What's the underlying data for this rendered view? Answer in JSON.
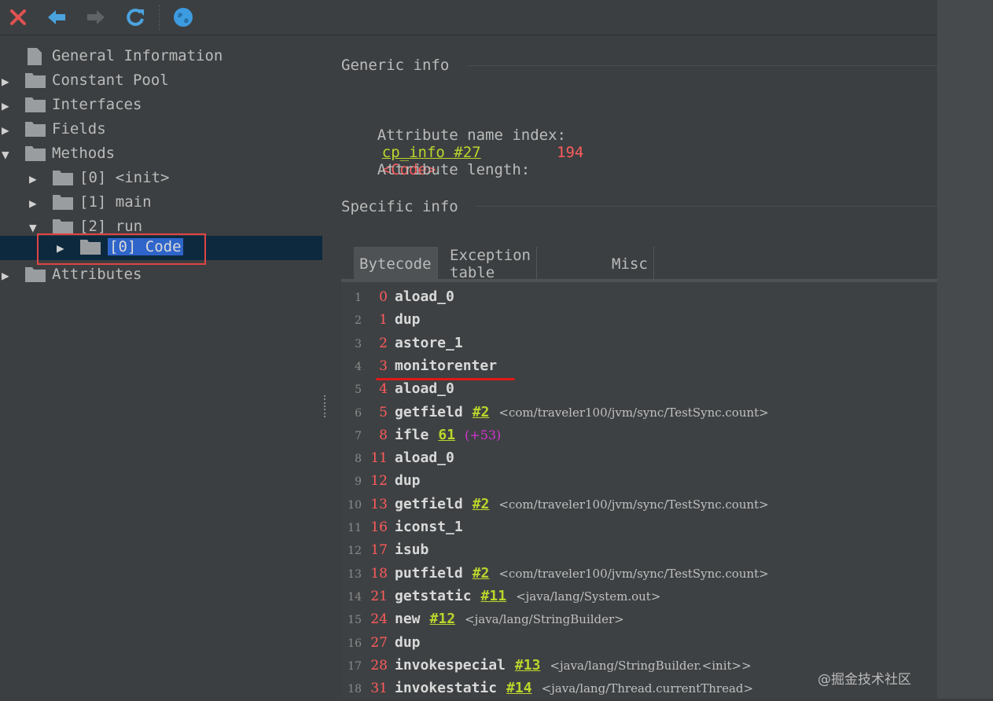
{
  "toolbar": {
    "buttons": [
      {
        "name": "close-button",
        "icon": "close-icon",
        "color": "#e05252"
      },
      {
        "name": "back-button",
        "icon": "arrow-left-icon",
        "color": "#4aa3df"
      },
      {
        "name": "forward-button",
        "icon": "arrow-right-icon",
        "color": "#666666"
      },
      {
        "name": "refresh-button",
        "icon": "refresh-icon",
        "color": "#4aa3df"
      },
      {
        "name": "browser-button",
        "icon": "globe-icon",
        "color": "#3d9be0"
      }
    ]
  },
  "tree": {
    "items": [
      {
        "label": "General Information",
        "icon": "file-icon",
        "expanded": null
      },
      {
        "label": "Constant Pool",
        "icon": "folder-icon",
        "expanded": false
      },
      {
        "label": "Interfaces",
        "icon": "folder-icon",
        "expanded": false
      },
      {
        "label": "Fields",
        "icon": "folder-icon",
        "expanded": false
      },
      {
        "label": "Methods",
        "icon": "folder-icon",
        "expanded": true
      },
      {
        "label": "[0] <init>",
        "icon": "folder-icon",
        "expanded": false
      },
      {
        "label": "[1] main",
        "icon": "folder-icon",
        "expanded": false
      },
      {
        "label": "[2] run",
        "icon": "folder-icon",
        "expanded": true
      },
      {
        "label": "[0] Code",
        "icon": "folder-icon",
        "expanded": false,
        "selected": true
      },
      {
        "label": "Attributes",
        "icon": "folder-icon",
        "expanded": false
      }
    ]
  },
  "generic": {
    "title": "Generic info",
    "name_index_label": "Attribute name index:",
    "name_index_link": "cp_info #27",
    "name_index_value": "<Code>",
    "length_label": "Attribute length:",
    "length_value": "194"
  },
  "specific": {
    "title": "Specific info",
    "tabs": [
      "Bytecode",
      "Exception table",
      "Misc"
    ],
    "active_tab": "Bytecode"
  },
  "bytecode": [
    {
      "n": "1",
      "off": "0",
      "op": "aload_0"
    },
    {
      "n": "2",
      "off": "1",
      "op": "dup"
    },
    {
      "n": "3",
      "off": "2",
      "op": "astore_1"
    },
    {
      "n": "4",
      "off": "3",
      "op": "monitorenter"
    },
    {
      "n": "5",
      "off": "4",
      "op": "aload_0"
    },
    {
      "n": "6",
      "off": "5",
      "op": "getfield",
      "ref": "#2",
      "cmt": "<com/traveler100/jvm/sync/TestSync.count>"
    },
    {
      "n": "7",
      "off": "8",
      "op": "ifle",
      "ref": "61",
      "jmp": "(+53)"
    },
    {
      "n": "8",
      "off": "11",
      "op": "aload_0"
    },
    {
      "n": "9",
      "off": "12",
      "op": "dup"
    },
    {
      "n": "10",
      "off": "13",
      "op": "getfield",
      "ref": "#2",
      "cmt": "<com/traveler100/jvm/sync/TestSync.count>"
    },
    {
      "n": "11",
      "off": "16",
      "op": "iconst_1"
    },
    {
      "n": "12",
      "off": "17",
      "op": "isub"
    },
    {
      "n": "13",
      "off": "18",
      "op": "putfield",
      "ref": "#2",
      "cmt": "<com/traveler100/jvm/sync/TestSync.count>"
    },
    {
      "n": "14",
      "off": "21",
      "op": "getstatic",
      "ref": "#11",
      "cmt": "<java/lang/System.out>"
    },
    {
      "n": "15",
      "off": "24",
      "op": "new",
      "ref": "#12",
      "cmt": "<java/lang/StringBuilder>"
    },
    {
      "n": "16",
      "off": "27",
      "op": "dup"
    },
    {
      "n": "17",
      "off": "28",
      "op": "invokespecial",
      "ref": "#13",
      "cmt": "<java/lang/StringBuilder.<init>>"
    },
    {
      "n": "18",
      "off": "31",
      "op": "invokestatic",
      "ref": "#14",
      "cmt": "<java/lang/Thread.currentThread>"
    }
  ],
  "watermark": "@掘金技术社区"
}
